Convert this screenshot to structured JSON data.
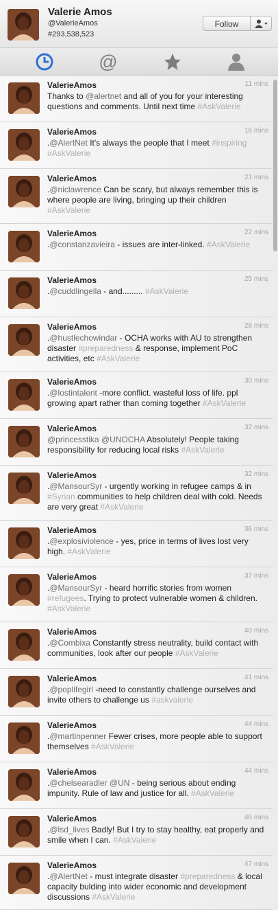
{
  "header": {
    "name": "Valerie Amos",
    "handle": "@ValerieAmos",
    "id_line": "#293,538,523",
    "follow_label": "Follow"
  },
  "tabs": [
    {
      "name": "tab-timeline",
      "icon": "clock-icon",
      "active": true
    },
    {
      "name": "tab-mentions",
      "icon": "at-icon",
      "active": false
    },
    {
      "name": "tab-favorites",
      "icon": "star-icon",
      "active": false
    },
    {
      "name": "tab-profile",
      "icon": "person-icon",
      "active": false
    }
  ],
  "colors": {
    "accent": "#2f6fd3",
    "link": "#6e6e6e",
    "hashtag": "#b0b0b0"
  },
  "tweets": [
    {
      "name": "ValerieAmos",
      "time": "11 mins",
      "text": "Thanks to @alertnet and all of you for your interesting questions and comments. Until next time #AskValerie"
    },
    {
      "name": "ValerieAmos",
      "time": "16 mins",
      "text": ".@AlertNet It's always the people that I meet #inspiring #AskValerie"
    },
    {
      "name": "ValerieAmos",
      "time": "21 mins",
      "text": ".@niclawrence Can be scary, but always remember this is where people are living, bringing up their children #AskValerie"
    },
    {
      "name": "ValerieAmos",
      "time": "22 mins",
      "text": ".@constanzavieira - issues are inter-linked. #AskValerie"
    },
    {
      "name": "ValerieAmos",
      "time": "25 mins",
      "text": ".@cuddlingella - and......... #AskValerie"
    },
    {
      "name": "ValerieAmos",
      "time": "28 mins",
      "text": ".@hustlechowindar - OCHA works with AU to strengthen disaster #preparedness & response, implement PoC activities, etc #AskValerie"
    },
    {
      "name": "ValerieAmos",
      "time": "30 mins",
      "text": ".@lostintalent -more conflict. wasteful loss of life. ppl growing apart rather than coming together #AskValerie"
    },
    {
      "name": "ValerieAmos",
      "time": "32 mins",
      "text": "@princesstika @UNOCHA Absolutely! People taking responsibility for reducing local risks #AskValerie"
    },
    {
      "name": "ValerieAmos",
      "time": "32 mins",
      "text": ".@MansourSyr - urgently working in refugee camps & in #Syrian communities to help children deal with cold. Needs are very great #AskValerie"
    },
    {
      "name": "ValerieAmos",
      "time": "36 mins",
      "text": ".@explosiviolence - yes, price in terms of lives lost very high. #AskValerie"
    },
    {
      "name": "ValerieAmos",
      "time": "37 mins",
      "text": ".@MansourSyr - heard horrific stories from women #refugees. Trying to protect vulnerable women & children. #AskValerie"
    },
    {
      "name": "ValerieAmos",
      "time": "40 mins",
      "text": ".@Combixa Constantly stress neutrality, build contact with communities, look after our people #AskValerie"
    },
    {
      "name": "ValerieAmos",
      "time": "41 mins",
      "text": ".@poplifegirl -need to constantly challenge ourselves and invite others to challenge us #askvalerie"
    },
    {
      "name": "ValerieAmos",
      "time": "44 mins",
      "text": ".@martinpenner Fewer crises, more people able to support themselves #AskValerie"
    },
    {
      "name": "ValerieAmos",
      "time": "44 mins",
      "text": ".@chelsearadler @UN - being serious about ending impunity. Rule of law and justice for all. #AskValerie"
    },
    {
      "name": "ValerieAmos",
      "time": "46 mins",
      "text": ".@lsd_lives Badly! But I try to stay healthy, eat properly and smile when I can. #AskValerie"
    },
    {
      "name": "ValerieAmos",
      "time": "47 mins",
      "text": ".@AlertNet - must integrate disaster #preparedness & local capacity bulding into wider economic and development discussions #AskValerie"
    }
  ]
}
